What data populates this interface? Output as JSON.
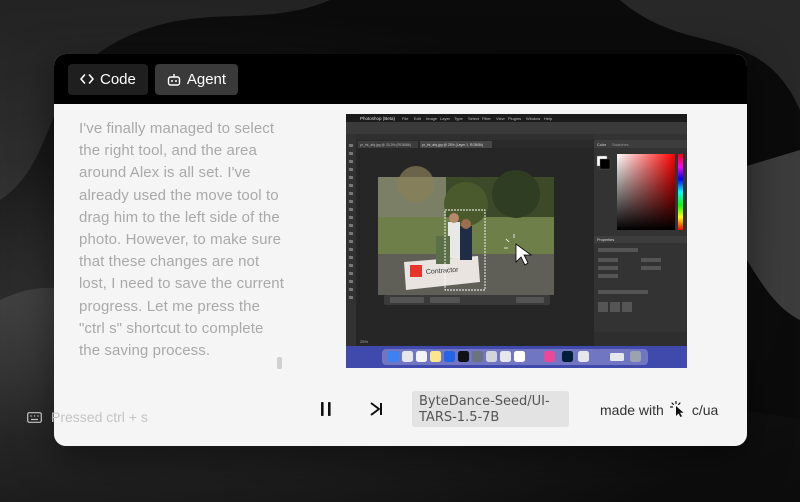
{
  "tabs": [
    {
      "label": "Code",
      "icon": "code-brackets-icon"
    },
    {
      "label": "Agent",
      "icon": "robot-icon"
    }
  ],
  "transcript": {
    "text": "I've finally managed to select the right tool, and the area around Alex is all set. I've already used the move tool to drag him to the left side of the photo. However, to make sure that these changes are not lost, I need to save the current progress. Let me press the \"ctrl s\" shortcut to complete the saving process."
  },
  "action": {
    "label": "Pressed ctrl + s",
    "icon": "keyboard-icon"
  },
  "screen": {
    "app": "Photoshop (Beta)",
    "menus": [
      "File",
      "Edit",
      "Image",
      "Layer",
      "Type",
      "Select",
      "Filter",
      "View",
      "Plugins",
      "Window",
      "Help"
    ],
    "doc_tab_1": "pr_int_afq.jpg @ 33.3% (RGB/8#)",
    "doc_tab_2": "pr_int_afq.jpg @ 25% (Layer 1, RGB/8#)",
    "sign_text": "Contractor",
    "panel_tab_color": "Color",
    "panel_tab_swatches": "Swatches",
    "panel_tab_properties": "Properties",
    "zoom_level": "25%",
    "accent": "#e8352c"
  },
  "playback": {
    "pause_icon": "pause-icon",
    "next_icon": "skip-forward-icon"
  },
  "model": {
    "name": "ByteDance-Seed/UI-TARS-1.5-7B"
  },
  "footer": {
    "made_with": "made with",
    "brand": "c/ua",
    "brand_icon": "cursor-click-icon"
  }
}
